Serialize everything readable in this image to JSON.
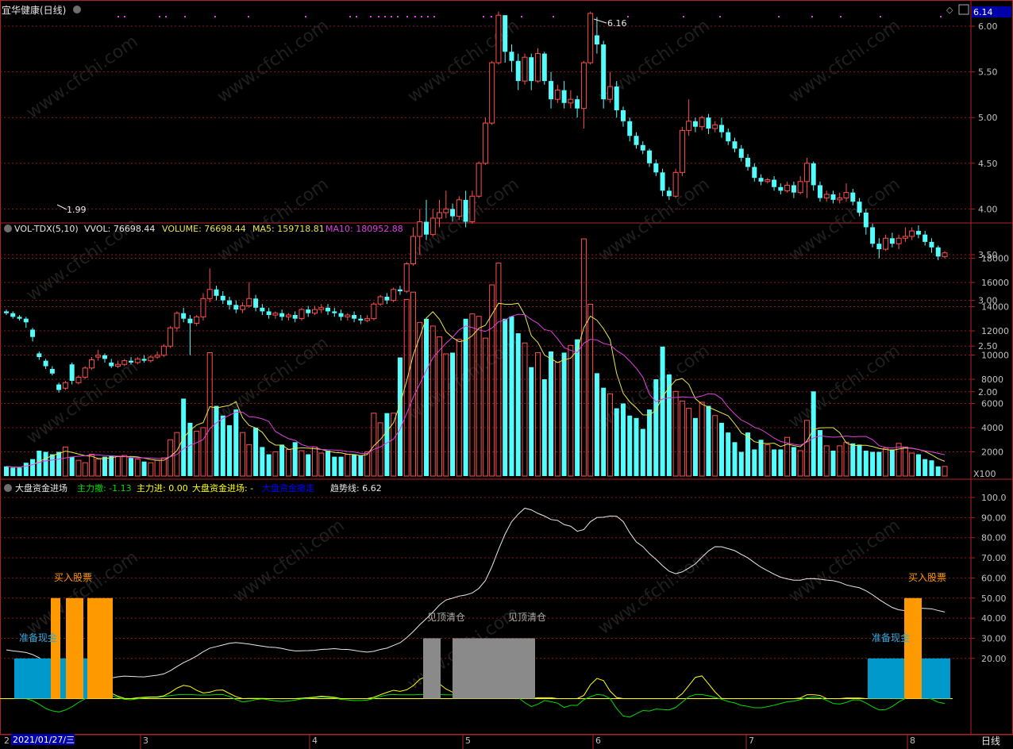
{
  "colors": {
    "bg": "#000000",
    "frame": "#b22222",
    "grid": "#8b1a1a",
    "axis_text": "#c0c0c0",
    "up": "#ff4f4f",
    "down": "#54fcfc",
    "ma5": "#e5e54e",
    "ma10": "#e040e0",
    "white": "#e8e8e8",
    "green": "#00dd00",
    "yellow": "#ffff00",
    "orange": "#ff9900",
    "blue_cash": "#0099cc",
    "grey": "#8a8a8a",
    "blue_text": "#0000ff",
    "header_blue": "#0000aa"
  },
  "watermark": "www.cfchi.com",
  "header": {
    "title": "宜华健康(日线)",
    "price_tag": "6.14"
  },
  "price_panel": {
    "yaxis": [
      "6.00",
      "5.50",
      "5.00",
      "4.50",
      "4.00",
      "3.50",
      "3.00",
      "2.50",
      "2.00"
    ],
    "high_label": "6.16",
    "low_label": "1.99"
  },
  "volume_panel": {
    "name": "VOL-TDX(5,10)",
    "vvol": "VVOL: 76698.44",
    "volume": "VOLUME: 76698.44",
    "ma5": "MA5: 159718.81",
    "ma10": "MA10: 180952.88",
    "yaxis": [
      "18000",
      "16000",
      "14000",
      "12000",
      "10000",
      "8000",
      "6000",
      "4000",
      "2000"
    ],
    "unit": "X100"
  },
  "indicator_panel": {
    "name": "大盘资金进场",
    "zl_out": "主力撤: -1.13",
    "zl_in": "主力进: 0.00",
    "dp_in": "大盘资金进场: -",
    "dp_out": "大盘资金撤走",
    "trend": "趋势线: 6.62",
    "yaxis": [
      "100.0",
      "90.00",
      "80.00",
      "70.00",
      "60.00",
      "50.00",
      "40.00",
      "30.00",
      "20.00"
    ],
    "buy_label": "买入股票",
    "cash_label": "准备现金",
    "sell_label": "见顶清仓"
  },
  "xaxis": {
    "date_box": "2021/01/27/三",
    "months": [
      "2",
      "3",
      "4",
      "5",
      "6",
      "7",
      "8"
    ],
    "period_button": "日线"
  },
  "candles": [
    [
      2.88,
      2.86,
      2.9,
      2.84
    ],
    [
      2.86,
      2.82,
      2.88,
      2.8
    ],
    [
      2.82,
      2.8,
      2.84,
      2.78
    ],
    [
      2.8,
      2.76,
      2.82,
      2.7
    ],
    [
      2.68,
      2.6,
      2.7,
      2.55
    ],
    [
      2.42,
      2.38,
      2.44,
      2.35
    ],
    [
      2.34,
      2.28,
      2.36,
      2.25
    ],
    [
      2.25,
      2.2,
      2.28,
      2.18
    ],
    [
      2.08,
      2.02,
      2.1,
      1.99
    ],
    [
      2.04,
      2.1,
      2.12,
      2.02
    ],
    [
      2.3,
      2.12,
      2.32,
      2.08
    ],
    [
      2.1,
      2.16,
      2.18,
      2.08
    ],
    [
      2.16,
      2.26,
      2.28,
      2.14
    ],
    [
      2.26,
      2.35,
      2.38,
      2.24
    ],
    [
      2.38,
      2.4,
      2.46,
      2.34
    ],
    [
      2.4,
      2.36,
      2.42,
      2.32
    ],
    [
      2.32,
      2.28,
      2.36,
      2.26
    ],
    [
      2.28,
      2.3,
      2.34,
      2.26
    ],
    [
      2.3,
      2.34,
      2.36,
      2.28
    ],
    [
      2.34,
      2.32,
      2.38,
      2.3
    ],
    [
      2.32,
      2.36,
      2.38,
      2.3
    ],
    [
      2.36,
      2.34,
      2.4,
      2.32
    ],
    [
      2.34,
      2.38,
      2.4,
      2.32
    ],
    [
      2.38,
      2.4,
      2.44,
      2.36
    ],
    [
      2.4,
      2.5,
      2.52,
      2.38
    ],
    [
      2.5,
      2.7,
      2.72,
      2.48
    ],
    [
      2.7,
      2.86,
      2.88,
      2.66
    ],
    [
      2.86,
      2.8,
      2.92,
      2.76
    ],
    [
      2.8,
      2.75,
      2.84,
      2.4
    ],
    [
      2.75,
      2.82,
      2.84,
      2.72
    ],
    [
      2.82,
      3.02,
      3.08,
      2.78
    ],
    [
      3.02,
      3.12,
      3.35,
      2.98
    ],
    [
      3.12,
      3.05,
      3.16,
      3.0
    ],
    [
      3.05,
      3.0,
      3.1,
      2.96
    ],
    [
      3.0,
      2.95,
      3.04,
      2.9
    ],
    [
      2.95,
      2.9,
      3.0,
      2.86
    ],
    [
      2.9,
      2.94,
      2.98,
      2.86
    ],
    [
      2.94,
      3.02,
      3.2,
      2.92
    ],
    [
      3.02,
      2.92,
      3.06,
      2.88
    ],
    [
      2.92,
      2.88,
      2.96,
      2.84
    ],
    [
      2.88,
      2.84,
      2.92,
      2.8
    ],
    [
      2.84,
      2.86,
      2.88,
      2.8
    ],
    [
      2.86,
      2.82,
      2.9,
      2.78
    ],
    [
      2.82,
      2.84,
      2.86,
      2.78
    ],
    [
      2.84,
      2.8,
      2.88,
      2.76
    ],
    [
      2.8,
      2.9,
      2.92,
      2.78
    ],
    [
      2.9,
      2.86,
      2.94,
      2.82
    ],
    [
      2.86,
      2.9,
      2.94,
      2.84
    ],
    [
      2.9,
      2.92,
      2.96,
      2.86
    ],
    [
      2.92,
      2.88,
      2.96,
      2.84
    ],
    [
      2.88,
      2.86,
      2.92,
      2.82
    ],
    [
      2.86,
      2.82,
      2.9,
      2.78
    ],
    [
      2.82,
      2.84,
      2.86,
      2.78
    ],
    [
      2.84,
      2.8,
      2.88,
      2.76
    ],
    [
      2.8,
      2.78,
      2.84,
      2.74
    ],
    [
      2.78,
      2.8,
      2.84,
      2.76
    ],
    [
      2.8,
      2.96,
      2.98,
      2.78
    ],
    [
      2.96,
      3.04,
      3.06,
      2.94
    ],
    [
      3.04,
      3.0,
      3.08,
      2.96
    ],
    [
      3.0,
      3.12,
      3.14,
      2.98
    ],
    [
      3.12,
      3.1,
      3.16,
      3.06
    ],
    [
      3.1,
      3.4,
      3.42,
      3.08
    ],
    [
      3.4,
      3.7,
      3.8,
      3.38
    ],
    [
      3.7,
      3.86,
      4.0,
      3.5
    ],
    [
      3.86,
      3.72,
      4.1,
      3.66
    ],
    [
      3.72,
      3.9,
      4.0,
      3.7
    ],
    [
      3.9,
      3.96,
      4.1,
      3.8
    ],
    [
      3.96,
      4.0,
      4.2,
      3.9
    ],
    [
      4.0,
      3.92,
      4.06,
      3.86
    ],
    [
      3.92,
      4.1,
      4.14,
      3.88
    ],
    [
      4.1,
      3.86,
      4.2,
      3.8
    ],
    [
      3.86,
      4.14,
      4.2,
      3.84
    ],
    [
      4.14,
      4.5,
      4.52,
      4.12
    ],
    [
      4.5,
      4.94,
      5.0,
      4.48
    ],
    [
      4.94,
      5.6,
      5.62,
      4.92
    ],
    [
      5.6,
      6.12,
      6.16,
      5.58
    ],
    [
      6.12,
      5.72,
      6.12,
      5.6
    ],
    [
      5.72,
      5.62,
      5.8,
      5.5
    ],
    [
      5.62,
      5.4,
      5.7,
      5.3
    ],
    [
      5.4,
      5.66,
      5.7,
      5.36
    ],
    [
      5.66,
      5.4,
      5.7,
      5.3
    ],
    [
      5.4,
      5.7,
      5.76,
      5.38
    ],
    [
      5.7,
      5.4,
      5.72,
      5.36
    ],
    [
      5.4,
      5.2,
      5.5,
      5.1
    ],
    [
      5.2,
      5.3,
      5.36,
      5.16
    ],
    [
      5.3,
      5.16,
      5.4,
      5.1
    ],
    [
      5.16,
      5.2,
      5.3,
      5.1
    ],
    [
      5.2,
      5.1,
      5.24,
      5.0
    ],
    [
      5.1,
      5.6,
      5.62,
      4.88
    ],
    [
      5.6,
      6.14,
      6.16,
      5.58
    ],
    [
      5.9,
      5.8,
      6.1,
      5.7
    ],
    [
      5.8,
      5.2,
      5.84,
      5.1
    ],
    [
      5.2,
      5.34,
      5.5,
      5.16
    ],
    [
      5.34,
      5.08,
      5.4,
      5.0
    ],
    [
      5.08,
      4.96,
      5.12,
      4.9
    ],
    [
      4.96,
      4.8,
      5.0,
      4.74
    ],
    [
      4.8,
      4.7,
      4.84,
      4.66
    ],
    [
      4.7,
      4.64,
      4.74,
      4.6
    ],
    [
      4.64,
      4.5,
      4.66,
      4.46
    ],
    [
      4.5,
      4.4,
      4.54,
      4.36
    ],
    [
      4.4,
      4.2,
      4.44,
      4.14
    ],
    [
      4.2,
      4.14,
      4.24,
      4.1
    ],
    [
      4.14,
      4.4,
      4.44,
      4.12
    ],
    [
      4.4,
      4.86,
      4.9,
      4.36
    ],
    [
      4.86,
      4.96,
      5.2,
      4.8
    ],
    [
      4.96,
      4.9,
      5.0,
      4.84
    ],
    [
      4.9,
      5.0,
      5.02,
      4.86
    ],
    [
      5.0,
      4.88,
      5.04,
      4.82
    ],
    [
      4.88,
      4.92,
      4.96,
      4.84
    ],
    [
      4.92,
      4.84,
      5.0,
      4.78
    ],
    [
      4.84,
      4.74,
      4.88,
      4.7
    ],
    [
      4.74,
      4.66,
      4.78,
      4.62
    ],
    [
      4.66,
      4.56,
      4.7,
      4.52
    ],
    [
      4.56,
      4.46,
      4.6,
      4.42
    ],
    [
      4.46,
      4.34,
      4.5,
      4.3
    ],
    [
      4.34,
      4.3,
      4.38,
      4.26
    ],
    [
      4.3,
      4.32,
      4.34,
      4.28
    ],
    [
      4.32,
      4.24,
      4.36,
      4.2
    ],
    [
      4.24,
      4.2,
      4.28,
      4.16
    ],
    [
      4.2,
      4.26,
      4.3,
      4.18
    ],
    [
      4.26,
      4.18,
      4.3,
      4.12
    ],
    [
      4.18,
      4.3,
      4.36,
      4.16
    ],
    [
      4.3,
      4.5,
      4.56,
      4.12
    ],
    [
      4.5,
      4.26,
      4.52,
      4.2
    ],
    [
      4.26,
      4.12,
      4.3,
      4.08
    ],
    [
      4.12,
      4.16,
      4.2,
      4.08
    ],
    [
      4.16,
      4.1,
      4.2,
      4.06
    ],
    [
      4.1,
      4.12,
      4.18,
      4.06
    ],
    [
      4.12,
      4.18,
      4.28,
      4.08
    ],
    [
      4.18,
      4.08,
      4.22,
      4.04
    ],
    [
      4.08,
      3.96,
      4.12,
      3.92
    ],
    [
      3.96,
      3.8,
      4.0,
      3.72
    ],
    [
      3.8,
      3.62,
      3.84,
      3.58
    ],
    [
      3.62,
      3.56,
      3.68,
      3.46
    ],
    [
      3.56,
      3.68,
      3.72,
      3.54
    ],
    [
      3.68,
      3.62,
      3.74,
      3.58
    ],
    [
      3.62,
      3.68,
      3.72,
      3.56
    ],
    [
      3.68,
      3.7,
      3.8,
      3.64
    ],
    [
      3.7,
      3.76,
      3.8,
      3.66
    ],
    [
      3.76,
      3.72,
      3.82,
      3.68
    ],
    [
      3.72,
      3.64,
      3.76,
      3.6
    ],
    [
      3.64,
      3.58,
      3.68,
      3.52
    ],
    [
      3.58,
      3.48,
      3.6,
      3.44
    ],
    [
      3.48,
      3.52,
      3.54,
      3.46
    ]
  ],
  "volumes": [
    800,
    700,
    700,
    1100,
    1400,
    2100,
    2000,
    1800,
    2000,
    2400,
    1600,
    1300,
    1100,
    1800,
    1400,
    1600,
    1700,
    1600,
    1700,
    1500,
    1400,
    1200,
    1100,
    1300,
    1500,
    3000,
    3600,
    6400,
    4400,
    3700,
    4000,
    10200,
    5800,
    5000,
    4200,
    5500,
    3600,
    2600,
    4000,
    2400,
    1800,
    2000,
    2600,
    2200,
    2800,
    2100,
    1800,
    2400,
    1900,
    2100,
    1600,
    1600,
    1800,
    1800,
    1700,
    2000,
    5200,
    4400,
    5200,
    5200,
    9800,
    14600,
    15200,
    12700,
    13000,
    12400,
    11500,
    10100,
    10200,
    11300,
    13000,
    13400,
    13200,
    11400,
    15800,
    17600,
    13000,
    13200,
    11800,
    11000,
    9000,
    10200,
    8000,
    10300,
    9400,
    10200,
    10800,
    11300,
    19600,
    14200,
    8500,
    7300,
    6800,
    5600,
    6000,
    5000,
    4800,
    3900,
    5500,
    8000,
    10700,
    8400,
    7000,
    6200,
    5600,
    4800,
    6100,
    5800,
    5000,
    4400,
    3600,
    2800,
    2000,
    3600,
    2200,
    3000,
    2600,
    2200,
    2200,
    3200,
    2400,
    2100,
    4600,
    7000,
    3800,
    2500,
    2100,
    2500,
    2800,
    2700,
    2600,
    2100,
    2000,
    2000,
    2300,
    2200,
    2700,
    2400,
    1900,
    1800,
    1400,
    1300,
    800,
    800
  ]
}
